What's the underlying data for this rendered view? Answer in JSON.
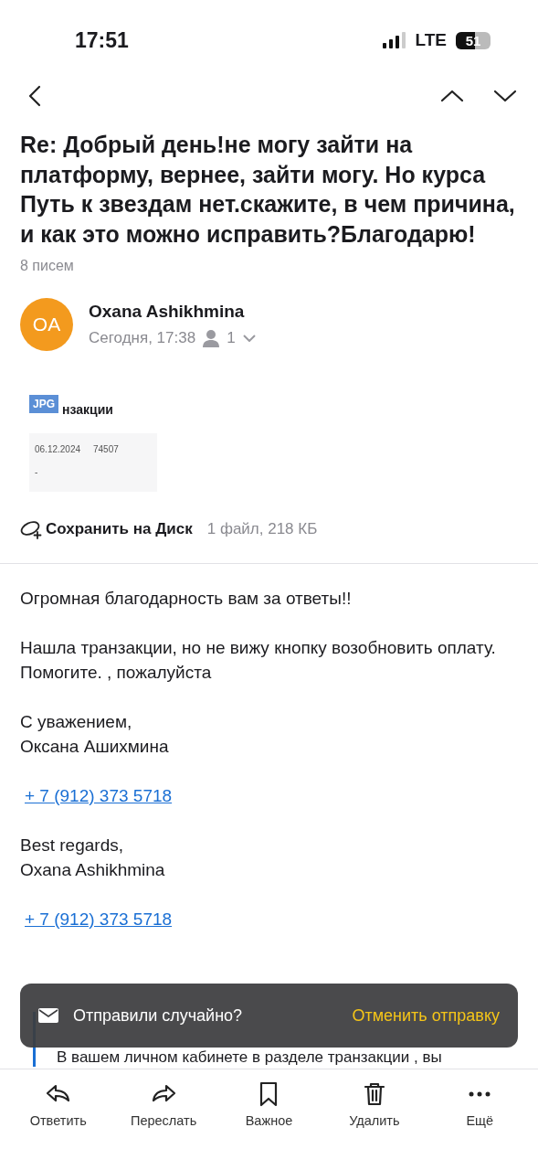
{
  "status_bar": {
    "time": "17:51",
    "network": "LTE",
    "battery": "51"
  },
  "nav": {
    "buttons": [
      {
        "kind": "back"
      },
      {
        "kind": "up"
      },
      {
        "kind": "down"
      }
    ]
  },
  "subject": "Re: Добрый день!не могу зайти на платформу, вернее, зайти могу. Но курса Путь к звездам нет.скажите, в чем причина, и как это можно исправить?Благодарю!",
  "count": "8 писем",
  "sender": {
    "initials": "OA",
    "color": "#f39a1e",
    "name": "Oxana Ashikhmina",
    "date": "Сегодня, 17:38",
    "recipients": "1"
  },
  "attachment": {
    "badge": "JPG",
    "title": "нзакции",
    "values": [
      "06.12.2024",
      "74507",
      "-"
    ]
  },
  "save": {
    "label": "Сохранить на Диск",
    "info": "1 файл, 218 КБ"
  },
  "body": [
    {
      "kind": "text",
      "lines": [
        "Огромная благодарность вам за ответы!!"
      ]
    },
    {
      "kind": "text",
      "lines": [
        "Нашла транзакции, но не вижу кнопку возобновить оплату. Помогите. , пожалуйста"
      ]
    },
    {
      "kind": "text",
      "lines": [
        "С уважением,",
        "Оксана Ашихмина"
      ]
    },
    {
      "kind": "link",
      "lines": [
        "+ 7 (912) 373 5718"
      ]
    },
    {
      "kind": "text",
      "lines": [
        "Best regards,",
        "Oxana Ashikhmina"
      ]
    },
    {
      "kind": "link",
      "lines": [
        "+ 7 (912) 373 5718"
      ]
    }
  ],
  "quote": {
    "text": "В вашем личном кабинете в разделе транзакции , вы"
  },
  "toast": {
    "message": "Отправили случайно?",
    "action": "Отменить отправку"
  },
  "toolbar": [
    {
      "kind": "reply",
      "label": "Ответить"
    },
    {
      "kind": "forward",
      "label": "Переслать"
    },
    {
      "kind": "bookmark",
      "label": "Важное"
    },
    {
      "kind": "trash",
      "label": "Удалить"
    },
    {
      "kind": "more",
      "label": "Ещё"
    }
  ]
}
